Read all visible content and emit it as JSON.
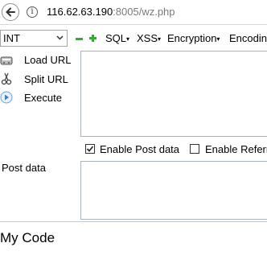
{
  "browser": {
    "url_host": "116.62.63.190",
    "url_rest": ":8005/wz.php"
  },
  "hackbar": {
    "select_value": "INT",
    "menus": [
      "SQL",
      "XSS",
      "Encryption",
      "Encoding"
    ],
    "actions": {
      "load_url": "Load URL",
      "split_url": "Split URL",
      "execute": "Execute"
    },
    "enable_post": "Enable Post data",
    "enable_referrer": "Enable Referrer",
    "post_label": "Post data"
  },
  "page": {
    "text": "My Code"
  },
  "colors": {
    "plus_green": "#3aa83a",
    "minus_green": "#3aa83a",
    "border": "#a9b4c2"
  }
}
